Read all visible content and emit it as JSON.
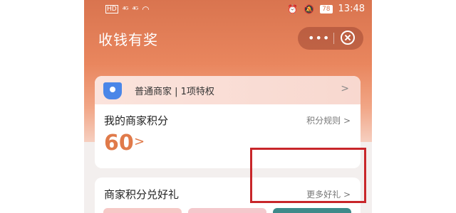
{
  "statusbar": {
    "hd": "HD",
    "sig1": "⁴ᴳ",
    "sig2": "⁴ᴳ",
    "battery": "78",
    "time": "13:48"
  },
  "nav": {
    "title": "收钱有奖",
    "more_glyph": "•••"
  },
  "tier": {
    "label": "普通商家 | 1项特权",
    "arrow": ">"
  },
  "points": {
    "title": "我的商家积分",
    "rule": "积分规则 >",
    "value": "60",
    "arrow": ">"
  },
  "gifts": {
    "title": "商家积分兑好礼",
    "more": "更多好礼 >"
  },
  "colors": {
    "accent": "#e07a4a",
    "highlight_box": "#c8262a",
    "tier_icon": "#4a86e8"
  }
}
